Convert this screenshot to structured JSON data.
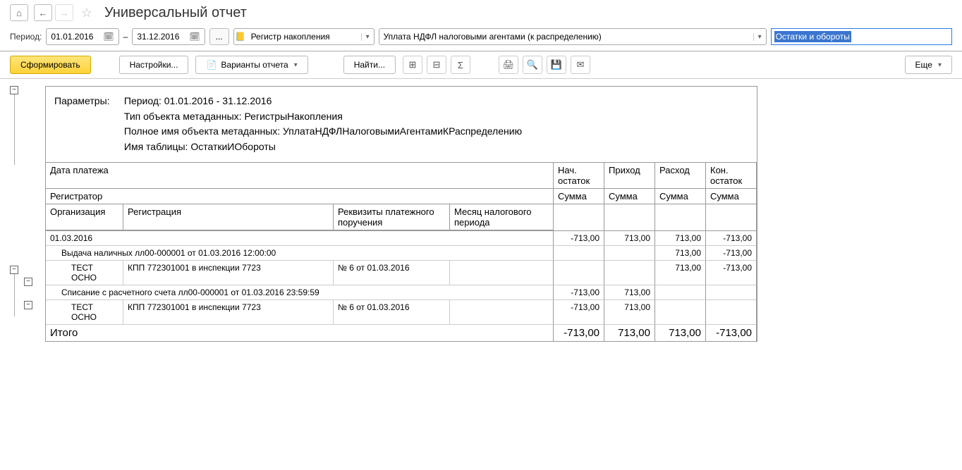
{
  "title": "Универсальный отчет",
  "period": {
    "label": "Период:",
    "from": "01.01.2016",
    "to": "31.12.2016",
    "dash": "–"
  },
  "ellipsis": "...",
  "register_combo": "Регистр накопления",
  "object_combo": "Уплата НДФЛ налоговыми агентами (к распределению)",
  "balance_input": "Остатки и обороты",
  "toolbar": {
    "generate": "Сформировать",
    "settings": "Настройки...",
    "variants": "Варианты отчета",
    "find": "Найти...",
    "more": "Еще"
  },
  "params": {
    "label": "Параметры:",
    "line1": "Период: 01.01.2016 - 31.12.2016",
    "line2": "Тип объекта метаданных: РегистрыНакопления",
    "line3": "Полное имя объекта метаданных: УплатаНДФЛНалоговымиАгентамиКРаспределению",
    "line4": "Имя таблицы: ОстаткиИОбороты"
  },
  "headers": {
    "date": "Дата платежа",
    "begin": "Нач. остаток",
    "income": "Приход",
    "expense": "Расход",
    "end": "Кон. остаток",
    "registrator": "Регистратор",
    "sum": "Сумма",
    "org": "Организация",
    "reg": "Регистрация",
    "req": "Реквизиты платежного поручения",
    "month": "Месяц налогового периода"
  },
  "rows": {
    "group_date": "01.03.2016",
    "group_vals": [
      "-713,00",
      "713,00",
      "713,00",
      "-713,00"
    ],
    "doc1": "Выдача наличных лл00-000001 от 01.03.2016 12:00:00",
    "doc1_vals": [
      "",
      "",
      "713,00",
      "-713,00"
    ],
    "det_org": "ТЕСТ ОСНО",
    "det_reg": "КПП 772301001 в инспекции 7723",
    "det_req": "№ 6 от 01.03.2016",
    "det1_vals": [
      "",
      "",
      "713,00",
      "-713,00"
    ],
    "doc2": "Списание с расчетного счета лл00-000001 от 01.03.2016 23:59:59",
    "doc2_vals": [
      "-713,00",
      "713,00",
      "",
      ""
    ],
    "det2_vals": [
      "-713,00",
      "713,00",
      "",
      ""
    ]
  },
  "totals": {
    "label": "Итого",
    "vals": [
      "-713,00",
      "713,00",
      "713,00",
      "-713,00"
    ]
  },
  "minus": "−"
}
